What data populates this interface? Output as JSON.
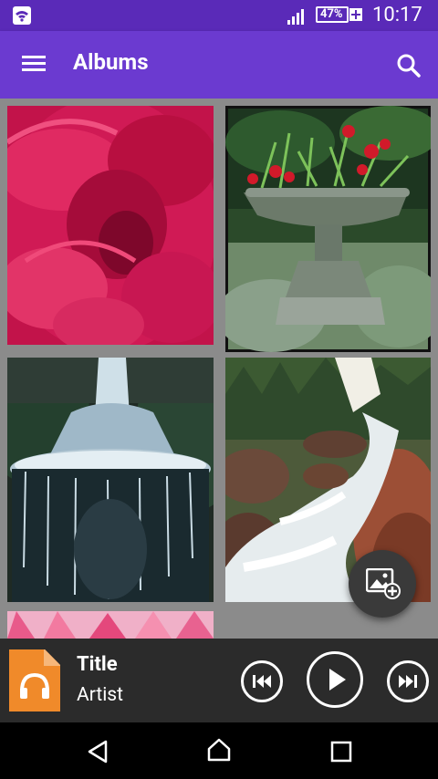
{
  "status_bar": {
    "time": "10:17",
    "battery_percent": "47%"
  },
  "app_bar": {
    "title": "Albums"
  },
  "albums": [
    {
      "name": "red-flower"
    },
    {
      "name": "garden-urn"
    },
    {
      "name": "fountain"
    },
    {
      "name": "waterfall"
    },
    {
      "name": "pink-flowers"
    }
  ],
  "now_playing": {
    "title": "Title",
    "artist": "Artist"
  },
  "colors": {
    "status_bar": "#5a2ab8",
    "app_bar": "#6b3ad0",
    "grid_bg": "#8b8b8b",
    "player_bg": "#2b2b2b",
    "album_art": "#f08a2a"
  }
}
